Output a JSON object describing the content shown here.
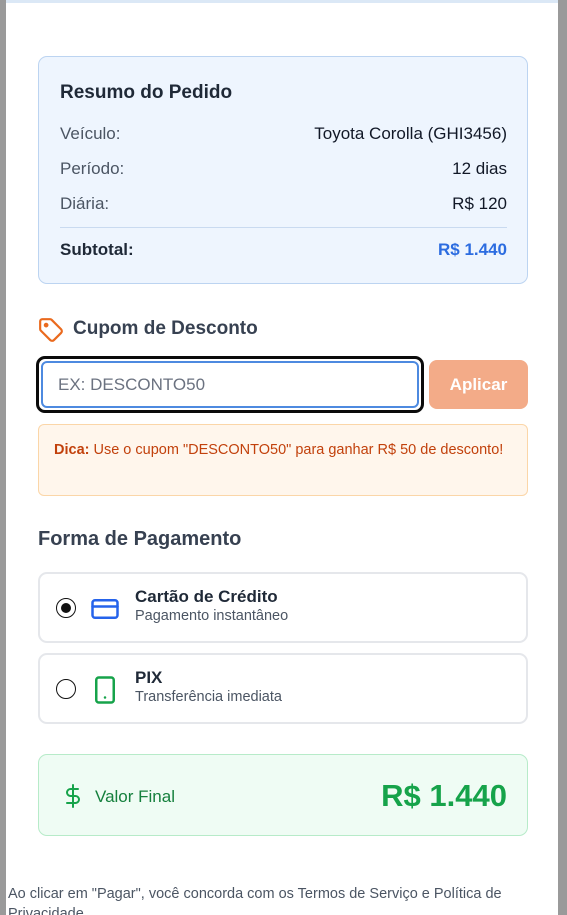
{
  "summary": {
    "title": "Resumo do Pedido",
    "rows": [
      {
        "label": "Veículo:",
        "value": "Toyota Corolla (GHI3456)"
      },
      {
        "label": "Período:",
        "value": "12 dias"
      },
      {
        "label": "Diária:",
        "value": "R$ 120"
      }
    ],
    "subtotal_label": "Subtotal:",
    "subtotal_value": "R$ 1.440"
  },
  "coupon": {
    "title": "Cupom de Desconto",
    "placeholder": "EX: DESCONTO50",
    "apply_label": "Aplicar",
    "tip_prefix": "Dica:",
    "tip_text": " Use o cupom \"DESCONTO50\" para ganhar R$ 50 de desconto!"
  },
  "payment": {
    "title": "Forma de Pagamento",
    "options": [
      {
        "label": "Cartão de Crédito",
        "sub": "Pagamento instantâneo",
        "icon": "credit-card-icon",
        "selected": true
      },
      {
        "label": "PIX",
        "sub": "Transferência imediata",
        "icon": "smartphone-icon",
        "selected": false
      }
    ]
  },
  "final": {
    "label": "Valor Final",
    "value": "R$ 1.440"
  },
  "terms": "Ao clicar em \"Pagar\", você concorda com os Termos de Serviço e Política de Privacidade",
  "colors": {
    "accent_blue": "#2c6ce0",
    "accent_orange": "#f3ab88",
    "success_green": "#16a34a",
    "tip_orange": "#c2410c"
  }
}
